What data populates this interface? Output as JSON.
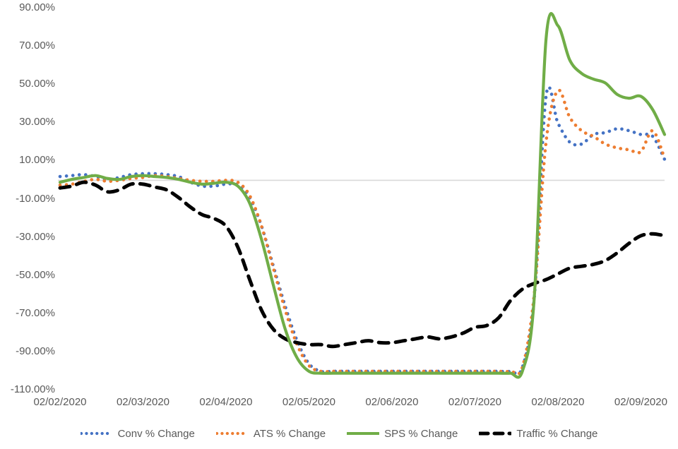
{
  "chart_data": {
    "type": "line",
    "title": "",
    "xlabel": "",
    "ylabel": "",
    "ylim": [
      -110,
      90
    ],
    "ytick_step": 20,
    "grid": false,
    "zero_line": true,
    "legend_position": "bottom",
    "y_tick_labels": [
      "90.00%",
      "70.00%",
      "50.00%",
      "30.00%",
      "10.00%",
      "-10.00%",
      "-30.00%",
      "-50.00%",
      "-70.00%",
      "-90.00%",
      "-110.00%"
    ],
    "y_tick_values": [
      90,
      70,
      50,
      30,
      10,
      -10,
      -30,
      -50,
      -70,
      -90,
      -110
    ],
    "x_tick_labels": [
      "02/02/2020",
      "02/03/2020",
      "02/04/2020",
      "02/05/2020",
      "02/06/2020",
      "02/07/2020",
      "02/08/2020",
      "02/09/2020"
    ],
    "x_tick_values": [
      0,
      7,
      14,
      21,
      28,
      35,
      42,
      49
    ],
    "x": [
      0,
      1,
      2,
      3,
      4,
      5,
      6,
      7,
      8,
      9,
      10,
      11,
      12,
      13,
      14,
      15,
      16,
      17,
      18,
      19,
      20,
      21,
      22,
      23,
      24,
      25,
      26,
      27,
      28,
      29,
      30,
      31,
      32,
      33,
      34,
      35,
      36,
      37,
      38,
      39,
      40,
      41,
      42,
      43,
      44,
      45,
      46,
      47,
      48,
      49,
      50,
      51
    ],
    "series": [
      {
        "name": "Conv % Change",
        "color": "#4472C4",
        "style": "dotted",
        "values": [
          2.0,
          2.5,
          3.0,
          2.0,
          0.5,
          1.5,
          3.0,
          3.5,
          3.5,
          3.0,
          2.0,
          -1.0,
          -3.0,
          -3.0,
          -2.0,
          -2.5,
          -9.0,
          -24.0,
          -45.0,
          -66.0,
          -84.0,
          -96.0,
          -100.0,
          -100.0,
          -100.0,
          -100.0,
          -100.0,
          -100.0,
          -100.0,
          -100.0,
          -100.0,
          -100.0,
          -100.0,
          -100.0,
          -100.0,
          -100.0,
          -100.0,
          -100.0,
          -100.0,
          -98.0,
          -62.0,
          44.0,
          30.0,
          20.0,
          19.0,
          24.0,
          25.0,
          27.0,
          26.0,
          24.0,
          23.0,
          11.0
        ]
      },
      {
        "name": "ATS % Change",
        "color": "#ED7D31",
        "style": "dotted",
        "values": [
          -2.5,
          -2.0,
          -0.5,
          0.5,
          -0.5,
          0.0,
          1.0,
          1.5,
          2.5,
          2.0,
          1.0,
          0.0,
          -0.5,
          -0.5,
          0.0,
          -1.0,
          -8.0,
          -24.0,
          -46.0,
          -68.0,
          -86.0,
          -97.0,
          -100.0,
          -100.0,
          -100.0,
          -100.0,
          -100.0,
          -100.0,
          -100.0,
          -100.0,
          -100.0,
          -100.0,
          -100.0,
          -100.0,
          -100.0,
          -100.0,
          -100.0,
          -100.0,
          -100.0,
          -98.0,
          -60.0,
          20.0,
          47.0,
          33.0,
          26.0,
          23.0,
          19.0,
          17.0,
          16.0,
          15.0,
          26.0,
          11.5
        ]
      },
      {
        "name": "SPS % Change",
        "color": "#70AD47",
        "style": "solid",
        "values": [
          -1.0,
          0.5,
          1.5,
          2.5,
          1.0,
          0.5,
          2.0,
          2.5,
          2.0,
          1.5,
          0.5,
          -1.0,
          -2.0,
          -1.5,
          -1.0,
          -3.0,
          -12.0,
          -31.0,
          -55.0,
          -78.0,
          -93.0,
          -100.0,
          -101.0,
          -101.0,
          -101.0,
          -101.0,
          -101.0,
          -101.0,
          -101.0,
          -101.0,
          -101.0,
          -101.0,
          -101.0,
          -101.0,
          -101.0,
          -101.0,
          -101.0,
          -101.0,
          -101.0,
          -100.0,
          -62.0,
          74.0,
          81.0,
          63.0,
          56.0,
          53.0,
          51.0,
          45.0,
          43.0,
          44.0,
          37.0,
          24.0
        ]
      },
      {
        "name": "Traffic % Change",
        "color": "#000000",
        "style": "dashed",
        "values": [
          -4.0,
          -3.0,
          -1.0,
          -2.5,
          -6.0,
          -5.0,
          -2.0,
          -2.0,
          -3.5,
          -5.0,
          -9.0,
          -14.0,
          -18.0,
          -20.0,
          -24.0,
          -35.0,
          -52.0,
          -68.0,
          -78.0,
          -83.0,
          -85.0,
          -86.0,
          -86.0,
          -87.0,
          -86.0,
          -85.0,
          -84.0,
          -85.0,
          -85.0,
          -84.0,
          -83.0,
          -82.0,
          -83.0,
          -82.0,
          -80.0,
          -77.0,
          -76.0,
          -72.0,
          -63.0,
          -57.0,
          -54.0,
          -52.0,
          -49.0,
          -46.0,
          -45.0,
          -44.0,
          -42.0,
          -38.0,
          -33.0,
          -29.0,
          -28.0,
          -29.0
        ]
      }
    ]
  },
  "legend": {
    "items": [
      {
        "label": "Conv % Change",
        "color": "#4472C4",
        "style": "dotted"
      },
      {
        "label": "ATS % Change",
        "color": "#ED7D31",
        "style": "dotted"
      },
      {
        "label": "SPS % Change",
        "color": "#70AD47",
        "style": "solid"
      },
      {
        "label": "Traffic % Change",
        "color": "#000000",
        "style": "dashed"
      }
    ]
  },
  "axes": {
    "zero_line_color": "#D9D9D9"
  }
}
